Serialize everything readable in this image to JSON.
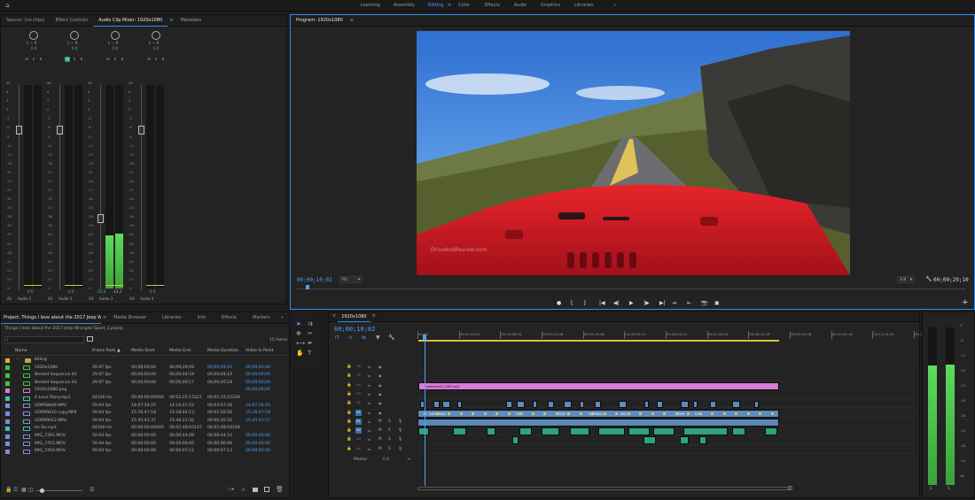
{
  "workspaces": [
    "Learning",
    "Assembly",
    "Editing",
    "Color",
    "Effects",
    "Audio",
    "Graphics",
    "Libraries"
  ],
  "active_workspace": "Editing",
  "more_workspaces": "»",
  "source_panel": {
    "tabs": [
      "Source: (no clips)",
      "Effect Controls",
      "Audio Clip Mixer: 1920x1080",
      "Metadata"
    ],
    "active_tab": "Audio Clip Mixer: 1920x1080",
    "channels": [
      {
        "name": "Audio 1",
        "track": "A1",
        "pan": "0.0",
        "lr": "L — R",
        "level": 0.0,
        "peak": ""
      },
      {
        "name": "Audio 2",
        "track": "A2",
        "pan": "0.0",
        "lr": "L — R",
        "level": 0.0,
        "peak": ""
      },
      {
        "name": "Audio 3",
        "track": "A3",
        "pan": "0.0",
        "lr": "L — R",
        "level": 0.62,
        "peak": "-13.5",
        "peak2": "-13.2"
      },
      {
        "name": "Audio 4",
        "track": "A4",
        "pan": "0.0",
        "lr": "L — R",
        "level": 0.0,
        "peak": ""
      }
    ],
    "msr": [
      "M",
      "S",
      "R"
    ],
    "db_scale": [
      "dB",
      "6",
      "3",
      "0",
      "-3",
      "-6",
      "-9",
      "-12",
      "-15",
      "-18",
      "-21",
      "-24",
      "-27",
      "-30",
      "-33",
      "-36",
      "-39",
      "-42",
      "-45",
      "-48",
      "-51",
      "-54",
      "-57",
      "-∞"
    ]
  },
  "program_monitor": {
    "title": "Program: 1920x1080",
    "timecode": "00;00;10;02",
    "fit": "Fit",
    "resolution": "1/4",
    "duration": "00;09;29;10",
    "watermark": "DriveAndReview.com",
    "transport": [
      "●",
      "{",
      "}",
      "|◀",
      "◀|",
      "▶",
      "|▶",
      "▶|",
      "⇥",
      "⇤",
      "📷",
      "▣"
    ],
    "add": "+"
  },
  "project_panel": {
    "tabs": [
      "Project: Things I love about the 2017 Jeep Wrangler Sport_1",
      "Media Browser",
      "Libraries",
      "Info",
      "Effects",
      "Markers"
    ],
    "more": "»",
    "project_file": "Things I love about the 2017 Jeep Wrangler Sport_1.prproj",
    "item_count": "15 Items",
    "columns": [
      "Name",
      "Frame Rate",
      "Media Start",
      "Media End",
      "Media Duration",
      "Video In Point"
    ],
    "rows": [
      {
        "color": "#e6a83a",
        "name": "billing",
        "fps": "",
        "start": "",
        "end": "",
        "dur": "",
        "vin": "",
        "folder": true
      },
      {
        "color": "#3fc23f",
        "name": "1920x1080",
        "fps": "29.97 fps",
        "start": "00;00;00;00",
        "end": "00;09;29;09",
        "dur": "00;09;29;10",
        "vin": "00;00;00;00"
      },
      {
        "color": "#3fc23f",
        "name": "Nested Sequence 02",
        "fps": "29.97 fps",
        "start": "00;00;00;00",
        "end": "00;00;04;18",
        "dur": "00;00;04;19",
        "vin": "00;00;00;00"
      },
      {
        "color": "#3fc23f",
        "name": "Nested Sequence 03",
        "fps": "29.97 fps",
        "start": "00;00;00;00",
        "end": "00;00;00;17",
        "dur": "00;00;00;18",
        "vin": "00;00;00;00"
      },
      {
        "color": "#d97ad6",
        "name": "1920x1080.png",
        "fps": "",
        "start": "",
        "end": "",
        "dur": "",
        "vin": "00;00;00;00"
      },
      {
        "color": "#3fc2a8",
        "name": "A Love Story.mp3",
        "fps": "44100 Hz",
        "start": "00:00:00:00000",
        "end": "00:02:25:15227",
        "dur": "00:02:25:15228",
        "vin": ""
      },
      {
        "color": "#7a8ce0",
        "name": "GOPR8849.MP4",
        "fps": "59.94 fps",
        "start": "14:07:34:25",
        "end": "14:10:41:52",
        "dur": "00:03:07:28",
        "vin": "14:07:34:25"
      },
      {
        "color": "#7a8ce0",
        "name": "GOPR9010 copy.MP4",
        "fps": "59.94 fps",
        "start": "15:26:47:18",
        "end": "15:28:44:13",
        "dur": "00:01:56:56",
        "vin": "15:26:47:18"
      },
      {
        "color": "#7a8ce0",
        "name": "GOPR9012.MP4",
        "fps": "59.94 fps",
        "start": "15:45:45:37",
        "end": "15:46:21:32",
        "dur": "00:00:35:56",
        "vin": "15:45:45:37"
      },
      {
        "color": "#3fc2a8",
        "name": "Im So.mp3",
        "fps": "44100 Hz",
        "start": "00:00:00:00000",
        "end": "00:02:48:03147",
        "dur": "00:02:48:03168",
        "vin": ""
      },
      {
        "color": "#7a8ce0",
        "name": "IMG_7391.MOV",
        "fps": "59.94 fps",
        "start": "00:00:00:00",
        "end": "00:00:44:09",
        "dur": "00:00:44:10",
        "vin": "00:00:00:00"
      },
      {
        "color": "#7a8ce0",
        "name": "IMG_7452.MOV",
        "fps": "59.94 fps",
        "start": "00:00:00:00",
        "end": "00:00:06:05",
        "dur": "00:00:06:06",
        "vin": "00:00:00:00"
      },
      {
        "color": "#7a8ce0",
        "name": "IMG_7459.MOV",
        "fps": "59.94 fps",
        "start": "00:00:00:00",
        "end": "00:00:07:12",
        "dur": "00:00:07:13",
        "vin": "00:00:00:00"
      }
    ]
  },
  "timeline": {
    "title": "1920x1080",
    "timecode": "00;00;10;02",
    "ruler": [
      "00;00",
      "00;01;04;02",
      "00;02;08;04",
      "00;03;12;06",
      "00;04;16;08",
      "00;05;20;10",
      "00;06;24;12",
      "00;07;28;14",
      "00;08;32;16",
      "00;09;36;18",
      "00;10;40;18",
      "00;11;44;20",
      "00;12;48"
    ],
    "video_tracks": [
      "V6",
      "V5",
      "V4",
      "V3",
      "V2",
      "V1"
    ],
    "audio_tracks": [
      "A1",
      "A2",
      "A3",
      "A4"
    ],
    "master": "Master",
    "master_value": "0.0",
    "pink_clip": "watermark_1080.psd",
    "v1_clips": [
      "GOPR8849",
      "GOP",
      "GOP",
      "GOPR9011",
      "IMG",
      "GOPR",
      "GOP"
    ]
  },
  "master_meter": {
    "scale": [
      "0",
      "-6",
      "-12",
      "-18",
      "-24",
      "-30",
      "-36",
      "-42",
      "-48",
      "-54",
      "dB"
    ],
    "solo": [
      "S",
      "S"
    ]
  },
  "colors": {
    "accent": "#2d8ceb",
    "timecode": "#4aa3ff",
    "green_meter": "#4fc24f",
    "audio_clip": "#2fa47c",
    "video_clip": "#5d8cc1",
    "pink_clip": "#d97ad6",
    "yellow_work": "#d6c33b"
  }
}
